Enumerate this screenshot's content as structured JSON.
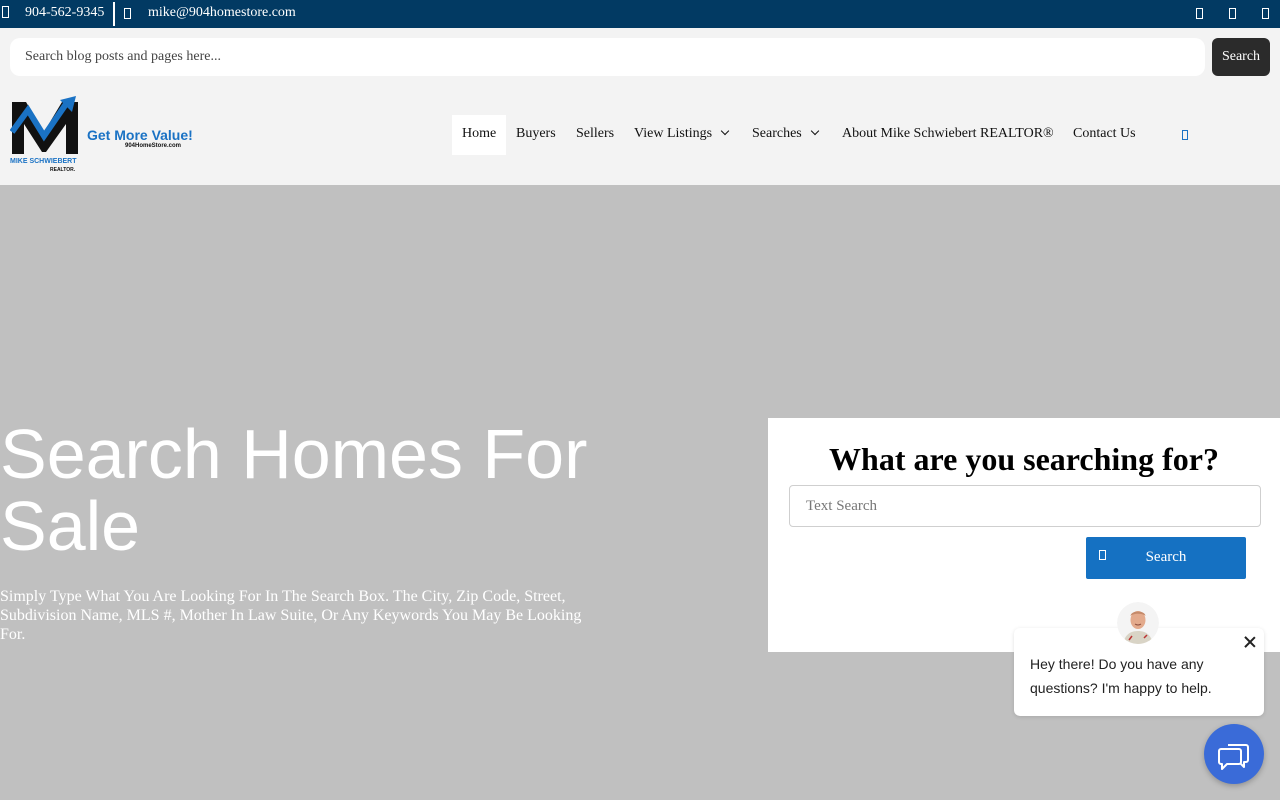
{
  "topbar": {
    "phone": "904-562-9345",
    "email": "mike@904homestore.com",
    "icons": [
      "phone-icon",
      "mail-icon",
      "facebook-icon",
      "instagram-icon",
      "linkedin-icon"
    ]
  },
  "blog_search": {
    "placeholder": "Search blog posts and pages here...",
    "button_label": "Search"
  },
  "logo": {
    "tagline": "Get More Value!",
    "website": "904HomeStore.com",
    "name": "MIKE SCHWIEBERT",
    "title": "REALTOR."
  },
  "nav": {
    "items": [
      {
        "label": "Home",
        "active": true
      },
      {
        "label": "Buyers"
      },
      {
        "label": "Sellers"
      },
      {
        "label": "View Listings",
        "dropdown": true
      },
      {
        "label": "Searches",
        "dropdown": true
      },
      {
        "label": "About Mike Schwiebert REALTOR®"
      },
      {
        "label": "Contact Us"
      }
    ],
    "search_icon": "search-icon"
  },
  "hero": {
    "title": "Search Homes For Sale",
    "subtitle": "Simply Type What You Are Looking For In The Search Box. The City, Zip Code, Street, Subdivision Name, MLS #, Mother In Law Suite, Or Any Keywords You May Be Looking For."
  },
  "search_card": {
    "title": "What are you searching for?",
    "placeholder": "Text Search",
    "button_label": "Search"
  },
  "chat": {
    "message": "Hey there! Do you have any questions? I'm happy to help."
  },
  "colors": {
    "topbar": "#023a63",
    "accent": "#1571c2",
    "hero_bg": "#c0c0c0",
    "chat_launcher": "#3a6bd8"
  }
}
